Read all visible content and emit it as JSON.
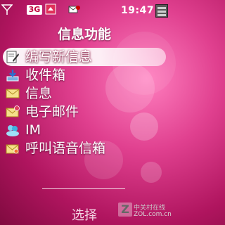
{
  "status_bar": {
    "network": "3G",
    "time": "19:47",
    "icons": [
      "signal-icon",
      "network-3g-icon",
      "upload-icon",
      "message-icon",
      "battery-icon"
    ]
  },
  "screen": {
    "title": "信息功能"
  },
  "menu": {
    "selected_index": 0,
    "items": [
      {
        "label": "编写新信息",
        "icon": "compose-icon"
      },
      {
        "label": "收件箱",
        "icon": "inbox-icon"
      },
      {
        "label": "信息",
        "icon": "envelope-icon"
      },
      {
        "label": "电子邮件",
        "icon": "email-icon"
      },
      {
        "label": "IM",
        "icon": "im-icon"
      },
      {
        "label": "呼叫语音信箱",
        "icon": "voicemail-icon"
      }
    ]
  },
  "softkey": {
    "center_label": "选择"
  },
  "watermark": {
    "logo_letter": "Z",
    "brand_cn": "中关村在线",
    "url": "ZOL.com.cn"
  },
  "colors": {
    "background": "#d0307a",
    "highlight": "#ffffff",
    "text": "#ffffff"
  }
}
